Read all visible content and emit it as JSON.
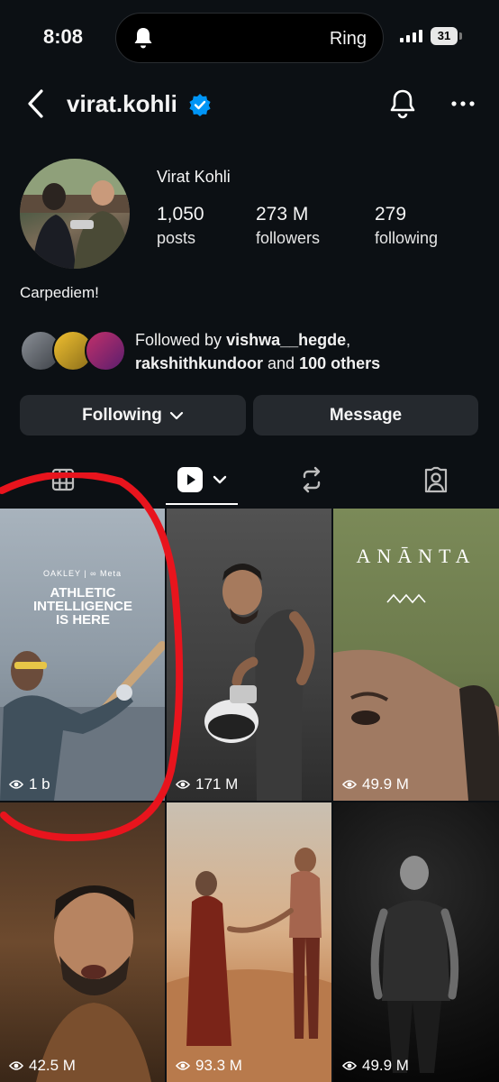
{
  "status_bar": {
    "time": "8:08",
    "island_text": "Ring",
    "battery": "31"
  },
  "header": {
    "username": "virat.kohli"
  },
  "profile": {
    "full_name": "Virat Kohli",
    "stats": [
      {
        "value": "1,050",
        "label": "posts"
      },
      {
        "value": "273 M",
        "label": "followers"
      },
      {
        "value": "279",
        "label": "following"
      }
    ],
    "bio": "Carpediem!",
    "followed_by": {
      "prefix": "Followed by ",
      "user1": "vishwa__hegde",
      "sep": ",",
      "user2": "rakshithkundoor",
      "middle": " and ",
      "others": "100 others"
    }
  },
  "buttons": {
    "following": "Following",
    "message": "Message"
  },
  "tiles": [
    {
      "views": "1 b",
      "overlay_brand": "OAKLEY | ∞ Meta",
      "overlay_text": "ATHLETIC INTELLIGENCE IS HERE"
    },
    {
      "views": "171 M"
    },
    {
      "views": "49.9 M",
      "overlay_text": "ANĀNTA"
    },
    {
      "views": "42.5 M"
    },
    {
      "views": "93.3 M"
    },
    {
      "views": "49.9 M"
    }
  ],
  "colors": {
    "background": "#0c1014",
    "button": "#25292e",
    "verified": "#0095f6",
    "annotation": "#e8141d"
  }
}
